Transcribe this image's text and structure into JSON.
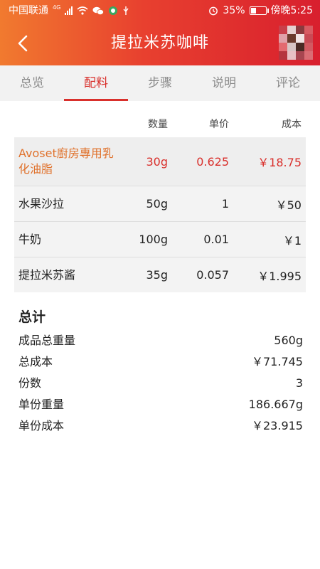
{
  "status_bar": {
    "carrier": "中国联通",
    "network_type": "4G",
    "battery_pct": "35%",
    "battery_level": 0.35,
    "time": "傍晚5:25"
  },
  "header": {
    "title": "提拉米苏咖啡",
    "back_icon": "chevron-left-icon"
  },
  "tabs": [
    {
      "label": "总览",
      "active": false
    },
    {
      "label": "配料",
      "active": true
    },
    {
      "label": "步骤",
      "active": false
    },
    {
      "label": "说明",
      "active": false
    },
    {
      "label": "评论",
      "active": false
    }
  ],
  "table": {
    "headers": {
      "qty": "数量",
      "price": "单价",
      "cost": "成本"
    },
    "rows": [
      {
        "name": "Avoset廚房專用乳化油脂",
        "qty": "30g",
        "price": "0.625",
        "cost": "￥18.75",
        "highlight": true
      },
      {
        "name": "水果沙拉",
        "qty": "50g",
        "price": "1",
        "cost": "￥50",
        "highlight": false
      },
      {
        "name": "牛奶",
        "qty": "100g",
        "price": "0.01",
        "cost": "￥1",
        "highlight": false
      },
      {
        "name": "提拉米苏酱",
        "qty": "35g",
        "price": "0.057",
        "cost": "￥1.995",
        "highlight": false
      }
    ]
  },
  "summary": {
    "title": "总计",
    "items": [
      {
        "label": "成品总重量",
        "value": "560g"
      },
      {
        "label": "总成本",
        "value": "￥71.745"
      },
      {
        "label": "份数",
        "value": "3"
      },
      {
        "label": "单份重量",
        "value": "186.667g"
      },
      {
        "label": "单份成本",
        "value": "￥23.915"
      }
    ]
  },
  "colors": {
    "accent": "#d9302c",
    "highlight_text": "#e0712b",
    "header_start": "#f17a2f",
    "header_end": "#d81f2e"
  }
}
